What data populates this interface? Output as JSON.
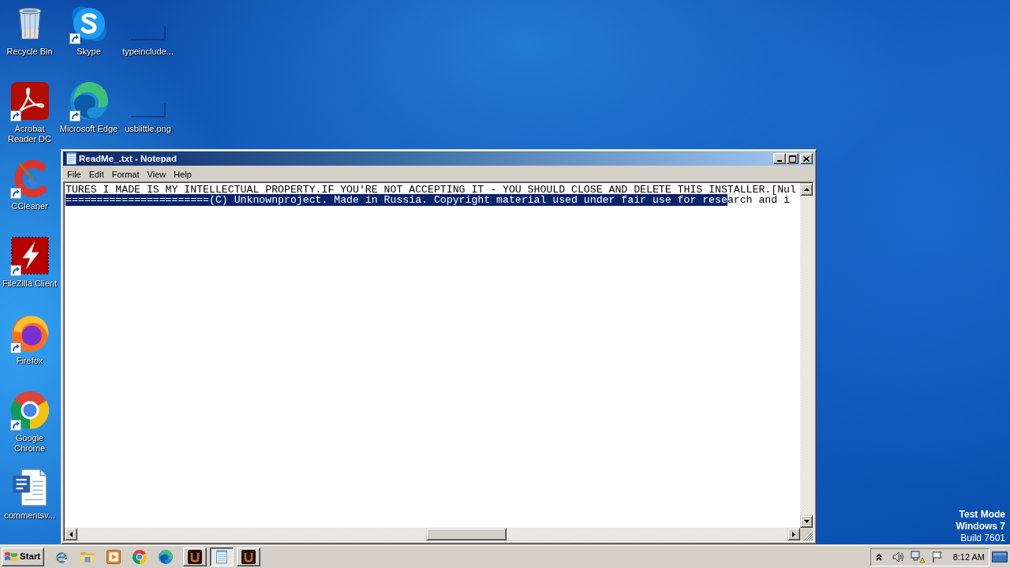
{
  "desktop": {
    "icon_columns": [
      [
        {
          "label": "Recycle Bin",
          "kind": "bin",
          "shortcut": false
        },
        {
          "label": "Acrobat Reader DC",
          "kind": "acrobat",
          "shortcut": true
        },
        {
          "label": "CCleaner",
          "kind": "ccleaner",
          "shortcut": true
        },
        {
          "label": "FileZilla Client",
          "kind": "filezilla",
          "shortcut": true
        },
        {
          "label": "Firefox",
          "kind": "firefox",
          "shortcut": true
        },
        {
          "label": "Google Chrome",
          "kind": "chrome",
          "shortcut": true
        },
        {
          "label": "commentsv...",
          "kind": "word",
          "shortcut": false
        }
      ],
      [
        {
          "label": "Skype",
          "kind": "skype",
          "shortcut": true
        },
        {
          "label": "Microsoft Edge",
          "kind": "edge",
          "shortcut": true
        }
      ],
      [
        {
          "label": "typeinclude...",
          "kind": "image",
          "shortcut": false
        },
        {
          "label": "usblittle.png",
          "kind": "image",
          "shortcut": false
        }
      ]
    ],
    "os_notice": {
      "mode": "Test Mode",
      "edition": "Windows 7",
      "build": "Build 7601"
    }
  },
  "notepad": {
    "title": "ReadMe_.txt - Notepad",
    "active": true,
    "menu": [
      "File",
      "Edit",
      "Format",
      "View",
      "Help"
    ],
    "lines": [
      {
        "segments": [
          {
            "text": "TURES I MADE IS MY INTELLECTUAL PROPERTY.IF YOU'RE NOT ACCEPTING IT - YOU SHOULD CLOSE AND DELETE THIS INSTALLER.[Nul",
            "selected": false
          }
        ]
      },
      {
        "segments": [
          {
            "text": "=======================(C) Unknownproject. Made in Russia. Copyright material used under fair use for rese",
            "selected": true
          },
          {
            "text": "arch and i",
            "selected": false
          }
        ]
      }
    ]
  },
  "taskbar": {
    "start_label": "Start",
    "quick_launch": [
      {
        "kind": "ie"
      },
      {
        "kind": "folder"
      },
      {
        "kind": "media"
      },
      {
        "kind": "chrome"
      },
      {
        "kind": "edge"
      }
    ],
    "tasks": [
      {
        "kind": "app",
        "selected": false
      },
      {
        "kind": "notepad",
        "selected": true
      },
      {
        "kind": "app",
        "selected": false
      }
    ],
    "clock": "8:12 AM"
  }
}
